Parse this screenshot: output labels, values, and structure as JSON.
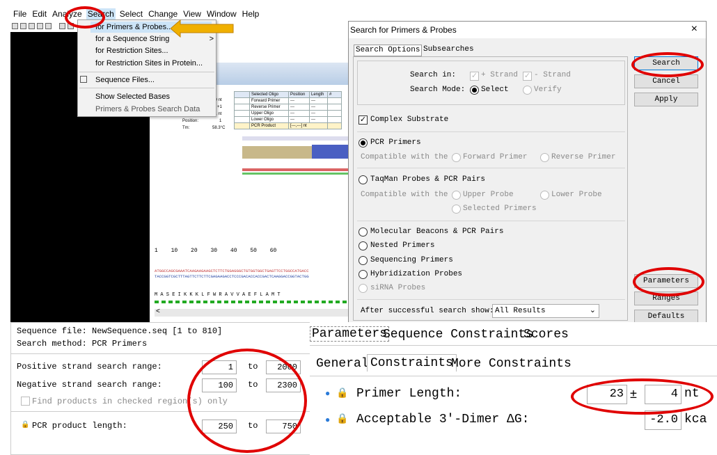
{
  "menubar": [
    "File",
    "Edit",
    "Analyze",
    "Search",
    "Select",
    "Change",
    "View",
    "Window",
    "Help"
  ],
  "search_menu": {
    "items": [
      "for Primers & Probes...",
      "for a Sequence String",
      "for Restriction Sites...",
      "for Restriction Sites in Protein...",
      "Sequence Files...",
      "Show Selected Bases",
      "Primers & Probes Search Data"
    ],
    "submenu_arrow": ">"
  },
  "bg_window": {
    "table_headers": [
      "Selected Oligo",
      "Position",
      "Length",
      "#"
    ],
    "rows": [
      {
        "name": "Forward Primer",
        "pos": "---",
        "len": "---"
      },
      {
        "name": "Reverse Primer",
        "pos": "---",
        "len": "---"
      },
      {
        "name": "Upper Oligo",
        "pos": "---",
        "len": "---"
      },
      {
        "name": "Lower Oligo",
        "pos": "---",
        "len": "---"
      },
      {
        "name": "PCR Product",
        "pos": "[---,---] nt",
        "len": ""
      }
    ],
    "left_vals": [
      "810 nt",
      "+1",
      "21 nt",
      "1",
      "58.3°C"
    ],
    "left_labels": [
      "Position:",
      "Tm:"
    ],
    "ruler": [
      "1",
      "10",
      "20",
      "30",
      "40",
      "50",
      "60"
    ],
    "seq_top": "ATGGCCAGCGAAATCAAGAAGAAGCTCTTCTGGAGGGCTGTGGTGGCTGAGTTCCTGGCCATGACC",
    "seq_bottom": "TACCGGTCGCTTTAGTTCTTCTTCGAGAAGACCTCCCGACACCACCGACTCAAGGACCGGTACTGG",
    "protein": "M A S E I K K K L F W R A V V A E F L A M T"
  },
  "dialog": {
    "title": "Search for Primers & Probes",
    "tabs": [
      "Search Options",
      "Subsearches"
    ],
    "search_in_label": "Search in:",
    "plus_strand": "+ Strand",
    "minus_strand": "- Strand",
    "search_mode_label": "Search Mode:",
    "mode_select": "Select",
    "mode_verify": "Verify",
    "complex_substrate": "Complex Substrate",
    "pcr_primers": "PCR Primers",
    "compatible_with": "Compatible with the",
    "forward_primer": "Forward Primer",
    "reverse_primer": "Reverse Primer",
    "taqman": "TaqMan Probes & PCR Pairs",
    "upper_probe": "Upper Probe",
    "lower_probe": "Lower Probe",
    "selected_primers": "Selected Primers",
    "molecular_beacons": "Molecular Beacons & PCR Pairs",
    "nested_primers": "Nested Primers",
    "sequencing_primers": "Sequencing Primers",
    "hybridization_probes": "Hybridization Probes",
    "sirna_probes": "siRNA Probes",
    "after_search_label": "After successful search show:",
    "after_search_value": "All Results",
    "buttons": {
      "search": "Search",
      "cancel": "Cancel",
      "apply": "Apply",
      "parameters": "Parameters",
      "ranges": "Ranges",
      "defaults": "Defaults"
    },
    "close": "×"
  },
  "bottom_left": {
    "sequence_file": "Sequence file: NewSequence.seq  [1 to 810]",
    "search_method": "Search method: PCR Primers",
    "pos_range_label": "Positive strand search range:",
    "pos_from": "1",
    "pos_to": "2000",
    "neg_range_label": "Negative strand search range:",
    "neg_from": "100",
    "neg_to": "2300",
    "to": "to",
    "find_products": "Find products in checked region(s) only",
    "pcr_len_label": "PCR product length:",
    "pcr_from": "250",
    "pcr_to": "750"
  },
  "bottom_right": {
    "tabs": [
      "Parameters",
      "Sequence Constraints",
      "Scores"
    ],
    "subtabs": [
      "General",
      "Constraints",
      "More Constraints"
    ],
    "primer_length_label": "Primer Length:",
    "primer_length": "23",
    "pm": "±",
    "primer_tol": "4",
    "unit_nt": "nt",
    "dimer_label": "Acceptable 3'-Dimer ΔG:",
    "dimer_value": "-2.0",
    "unit_kcal": "kca"
  },
  "colors": {
    "highlight_red": "#e00000",
    "arrow_orange": "#f0b000",
    "accent_blue": "#0078d7"
  }
}
